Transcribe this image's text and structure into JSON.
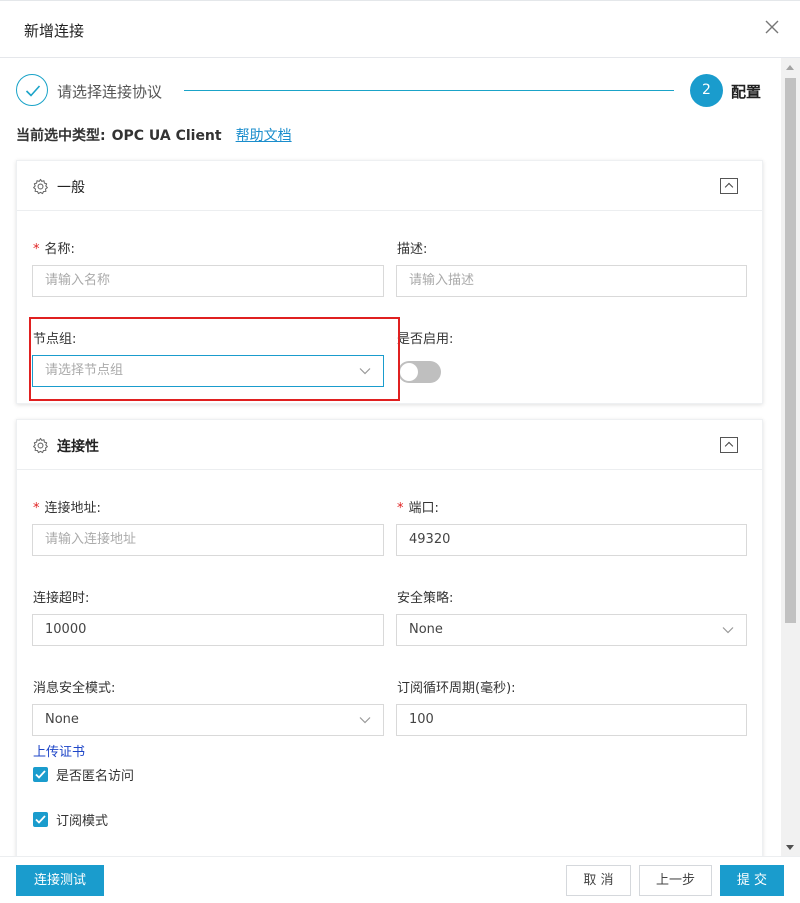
{
  "dialog": {
    "title": "新增连接",
    "close_icon": "close-icon"
  },
  "steps": {
    "step1_label": "请选择连接协议",
    "step2_number": "2",
    "step2_label": "配置"
  },
  "type_info": {
    "label": "当前选中类型:",
    "value": "OPC UA Client",
    "help_link": "帮助文档"
  },
  "general": {
    "title": "一般",
    "name_label": "名称:",
    "name_placeholder": "请输入名称",
    "desc_label": "描述:",
    "desc_placeholder": "请输入描述",
    "node_group_label": "节点组:",
    "node_group_placeholder": "请选择节点组",
    "enable_label": "是否启用:",
    "enable_value": false
  },
  "connectivity": {
    "title": "连接性",
    "address_label": "连接地址:",
    "address_placeholder": "请输入连接地址",
    "port_label": "端口:",
    "port_value": "49320",
    "timeout_label": "连接超时:",
    "timeout_value": "10000",
    "policy_label": "安全策略:",
    "policy_value": "None",
    "msg_mode_label": "消息安全模式:",
    "msg_mode_value": "None",
    "sub_period_label": "订阅循环周期(毫秒):",
    "sub_period_value": "100",
    "upload_cert": "上传证书",
    "anonymous_label": "是否匿名访问",
    "anonymous_checked": true,
    "subscribe_label": "订阅模式",
    "subscribe_checked": true
  },
  "footer": {
    "test_button": "连接测试",
    "cancel_button": "取 消",
    "prev_button": "上一步",
    "submit_button": "提 交"
  },
  "colors": {
    "accent": "#1a9ccd",
    "required": "#e02020",
    "link": "#1a8dcc"
  }
}
